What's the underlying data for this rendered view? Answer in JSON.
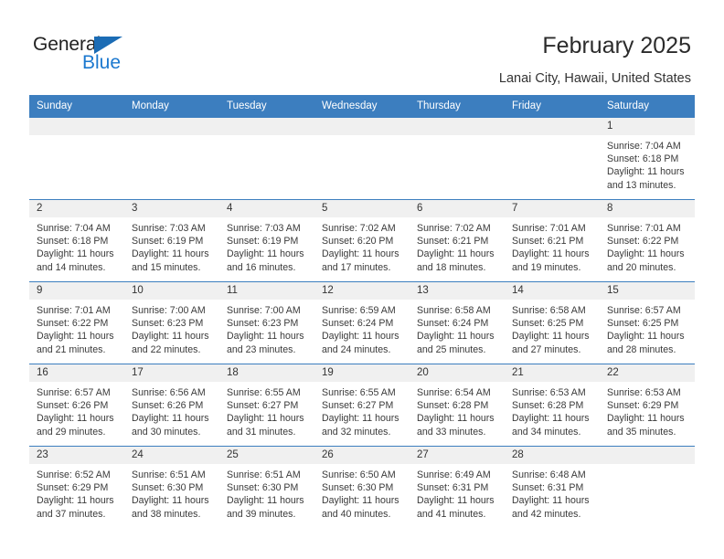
{
  "brand": {
    "name_top": "General",
    "name_bottom": "Blue",
    "triangle_color": "#1b6cb5",
    "blue_color": "#1b78cf"
  },
  "header": {
    "title": "February 2025",
    "subtitle": "Lanai City, Hawaii, United States",
    "header_bg": "#3c7ebf"
  },
  "weekdays": [
    "Sunday",
    "Monday",
    "Tuesday",
    "Wednesday",
    "Thursday",
    "Friday",
    "Saturday"
  ],
  "labels": {
    "sunrise": "Sunrise:",
    "sunset": "Sunset:",
    "daylight": "Daylight:"
  },
  "weeks": [
    [
      {
        "empty": true
      },
      {
        "empty": true
      },
      {
        "empty": true
      },
      {
        "empty": true
      },
      {
        "empty": true
      },
      {
        "empty": true
      },
      {
        "day": "1",
        "sunrise": "Sunrise: 7:04 AM",
        "sunset": "Sunset: 6:18 PM",
        "daylight": "Daylight: 11 hours and 13 minutes."
      }
    ],
    [
      {
        "day": "2",
        "sunrise": "Sunrise: 7:04 AM",
        "sunset": "Sunset: 6:18 PM",
        "daylight": "Daylight: 11 hours and 14 minutes."
      },
      {
        "day": "3",
        "sunrise": "Sunrise: 7:03 AM",
        "sunset": "Sunset: 6:19 PM",
        "daylight": "Daylight: 11 hours and 15 minutes."
      },
      {
        "day": "4",
        "sunrise": "Sunrise: 7:03 AM",
        "sunset": "Sunset: 6:19 PM",
        "daylight": "Daylight: 11 hours and 16 minutes."
      },
      {
        "day": "5",
        "sunrise": "Sunrise: 7:02 AM",
        "sunset": "Sunset: 6:20 PM",
        "daylight": "Daylight: 11 hours and 17 minutes."
      },
      {
        "day": "6",
        "sunrise": "Sunrise: 7:02 AM",
        "sunset": "Sunset: 6:21 PM",
        "daylight": "Daylight: 11 hours and 18 minutes."
      },
      {
        "day": "7",
        "sunrise": "Sunrise: 7:01 AM",
        "sunset": "Sunset: 6:21 PM",
        "daylight": "Daylight: 11 hours and 19 minutes."
      },
      {
        "day": "8",
        "sunrise": "Sunrise: 7:01 AM",
        "sunset": "Sunset: 6:22 PM",
        "daylight": "Daylight: 11 hours and 20 minutes."
      }
    ],
    [
      {
        "day": "9",
        "sunrise": "Sunrise: 7:01 AM",
        "sunset": "Sunset: 6:22 PM",
        "daylight": "Daylight: 11 hours and 21 minutes."
      },
      {
        "day": "10",
        "sunrise": "Sunrise: 7:00 AM",
        "sunset": "Sunset: 6:23 PM",
        "daylight": "Daylight: 11 hours and 22 minutes."
      },
      {
        "day": "11",
        "sunrise": "Sunrise: 7:00 AM",
        "sunset": "Sunset: 6:23 PM",
        "daylight": "Daylight: 11 hours and 23 minutes."
      },
      {
        "day": "12",
        "sunrise": "Sunrise: 6:59 AM",
        "sunset": "Sunset: 6:24 PM",
        "daylight": "Daylight: 11 hours and 24 minutes."
      },
      {
        "day": "13",
        "sunrise": "Sunrise: 6:58 AM",
        "sunset": "Sunset: 6:24 PM",
        "daylight": "Daylight: 11 hours and 25 minutes."
      },
      {
        "day": "14",
        "sunrise": "Sunrise: 6:58 AM",
        "sunset": "Sunset: 6:25 PM",
        "daylight": "Daylight: 11 hours and 27 minutes."
      },
      {
        "day": "15",
        "sunrise": "Sunrise: 6:57 AM",
        "sunset": "Sunset: 6:25 PM",
        "daylight": "Daylight: 11 hours and 28 minutes."
      }
    ],
    [
      {
        "day": "16",
        "sunrise": "Sunrise: 6:57 AM",
        "sunset": "Sunset: 6:26 PM",
        "daylight": "Daylight: 11 hours and 29 minutes."
      },
      {
        "day": "17",
        "sunrise": "Sunrise: 6:56 AM",
        "sunset": "Sunset: 6:26 PM",
        "daylight": "Daylight: 11 hours and 30 minutes."
      },
      {
        "day": "18",
        "sunrise": "Sunrise: 6:55 AM",
        "sunset": "Sunset: 6:27 PM",
        "daylight": "Daylight: 11 hours and 31 minutes."
      },
      {
        "day": "19",
        "sunrise": "Sunrise: 6:55 AM",
        "sunset": "Sunset: 6:27 PM",
        "daylight": "Daylight: 11 hours and 32 minutes."
      },
      {
        "day": "20",
        "sunrise": "Sunrise: 6:54 AM",
        "sunset": "Sunset: 6:28 PM",
        "daylight": "Daylight: 11 hours and 33 minutes."
      },
      {
        "day": "21",
        "sunrise": "Sunrise: 6:53 AM",
        "sunset": "Sunset: 6:28 PM",
        "daylight": "Daylight: 11 hours and 34 minutes."
      },
      {
        "day": "22",
        "sunrise": "Sunrise: 6:53 AM",
        "sunset": "Sunset: 6:29 PM",
        "daylight": "Daylight: 11 hours and 35 minutes."
      }
    ],
    [
      {
        "day": "23",
        "sunrise": "Sunrise: 6:52 AM",
        "sunset": "Sunset: 6:29 PM",
        "daylight": "Daylight: 11 hours and 37 minutes."
      },
      {
        "day": "24",
        "sunrise": "Sunrise: 6:51 AM",
        "sunset": "Sunset: 6:30 PM",
        "daylight": "Daylight: 11 hours and 38 minutes."
      },
      {
        "day": "25",
        "sunrise": "Sunrise: 6:51 AM",
        "sunset": "Sunset: 6:30 PM",
        "daylight": "Daylight: 11 hours and 39 minutes."
      },
      {
        "day": "26",
        "sunrise": "Sunrise: 6:50 AM",
        "sunset": "Sunset: 6:30 PM",
        "daylight": "Daylight: 11 hours and 40 minutes."
      },
      {
        "day": "27",
        "sunrise": "Sunrise: 6:49 AM",
        "sunset": "Sunset: 6:31 PM",
        "daylight": "Daylight: 11 hours and 41 minutes."
      },
      {
        "day": "28",
        "sunrise": "Sunrise: 6:48 AM",
        "sunset": "Sunset: 6:31 PM",
        "daylight": "Daylight: 11 hours and 42 minutes."
      },
      {
        "empty": true
      }
    ]
  ]
}
